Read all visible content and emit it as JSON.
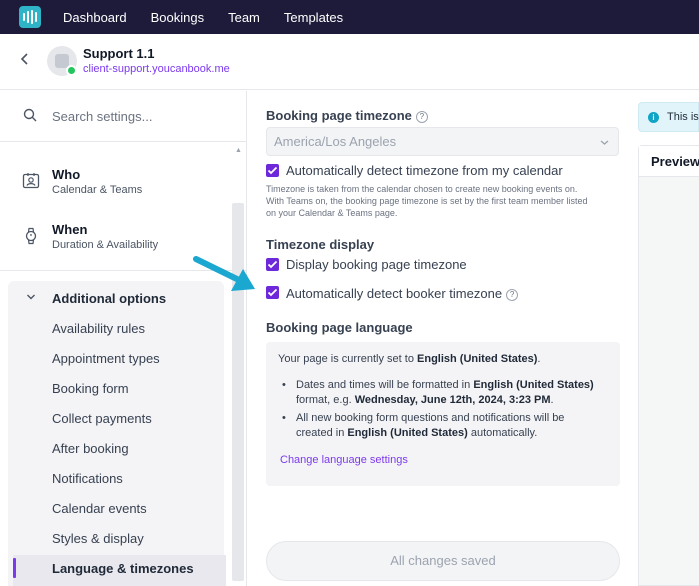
{
  "nav": {
    "logo_icon": "app-logo-icon",
    "items": [
      "Dashboard",
      "Bookings",
      "Team",
      "Templates"
    ]
  },
  "header": {
    "title": "Support 1.1",
    "subtitle": "client-support.youcanbook.me"
  },
  "sidebar": {
    "search_placeholder": "Search settings...",
    "sections": [
      {
        "title": "Who",
        "subtitle": "Calendar & Teams",
        "icon": "contact-card-icon"
      },
      {
        "title": "When",
        "subtitle": "Duration & Availability",
        "icon": "watch-icon"
      }
    ],
    "additional": {
      "label": "Additional options",
      "items": [
        "Availability rules",
        "Appointment types",
        "Booking form",
        "Collect payments",
        "After booking",
        "Notifications",
        "Calendar events",
        "Styles & display",
        "Language & timezones"
      ],
      "active_index": 8
    }
  },
  "main": {
    "timezone_label": "Booking page timezone",
    "timezone_value": "America/Los Angeles",
    "auto_detect_calendar": "Automatically detect timezone from my calendar",
    "note_line1": "Timezone is taken from the calendar chosen to create new booking events on.",
    "note_line2": "With Teams on, the booking page timezone is set by the first team member listed",
    "note_line3": "on your Calendar & Teams page.",
    "display_label": "Timezone display",
    "display_page_tz": "Display booking page timezone",
    "auto_detect_booker": "Automatically detect booker timezone",
    "language_label": "Booking page language",
    "language": {
      "intro_prefix": "Your page is currently set to ",
      "intro_lang": "English (United States)",
      "intro_suffix": ".",
      "b1_prefix": "Dates and times will be formatted in ",
      "b1_lang": "English (United States)",
      "b1_mid": "format, e.g. ",
      "b1_example": "Wednesday, June 12th, 2024, 3:23 PM",
      "b1_suffix": ".",
      "b2_prefix": "All new booking form questions and notifications will be",
      "b2_mid": "created in ",
      "b2_lang": "English (United States)",
      "b2_suffix": " automatically.",
      "link": "Change language settings"
    },
    "save_label": "All changes saved"
  },
  "preview": {
    "info_text": "This is",
    "tab_label": "Preview"
  },
  "colors": {
    "nav_bg": "#1e1b3a",
    "accent": "#6d28d9",
    "arrow": "#1aa7d0"
  }
}
